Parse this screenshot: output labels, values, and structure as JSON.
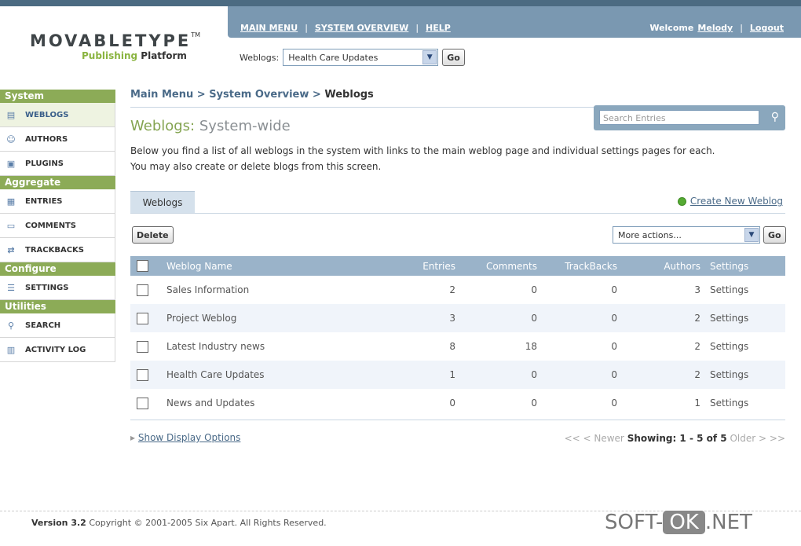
{
  "brand": {
    "logo_text": "MOVABLETYPE",
    "logo_tm": "TM",
    "sub1": "Publishing",
    "sub2": "Platform"
  },
  "topnav": {
    "items": [
      "MAIN MENU",
      "SYSTEM OVERVIEW",
      "HELP"
    ],
    "welcome": "Welcome",
    "user": "Melody",
    "logout": "Logout",
    "separator": "|"
  },
  "blog_selector": {
    "label": "Weblogs:",
    "selected": "Health Care Updates",
    "go": "Go"
  },
  "sidebar": {
    "sections": [
      {
        "title": "System",
        "items": [
          "WEBLOGS",
          "AUTHORS",
          "PLUGINS"
        ]
      },
      {
        "title": "Aggregate",
        "items": [
          "ENTRIES",
          "COMMENTS",
          "TRACKBACKS"
        ]
      },
      {
        "title": "Configure",
        "items": [
          "SETTINGS"
        ]
      },
      {
        "title": "Utilities",
        "items": [
          "SEARCH",
          "ACTIVITY LOG"
        ]
      }
    ]
  },
  "breadcrumb": {
    "items": [
      "Main Menu",
      "System Overview"
    ],
    "current": "Weblogs",
    "sep": ">"
  },
  "page": {
    "title_1": "Weblogs:",
    "title_2": "System-wide",
    "description_1": "Below you find a list of all weblogs in the system with links to the main weblog page and individual settings pages for each.",
    "description_2": "You may also create or delete blogs from this screen."
  },
  "search": {
    "placeholder": "Search Entries"
  },
  "tab": {
    "label": "Weblogs"
  },
  "actions": {
    "create": "Create New Weblog",
    "delete": "Delete",
    "more": "More actions...",
    "go": "Go"
  },
  "table": {
    "headers": [
      "Weblog Name",
      "Entries",
      "Comments",
      "TrackBacks",
      "Authors",
      "Settings"
    ],
    "rows": [
      {
        "name": "Sales Information",
        "entries": "2",
        "comments": "0",
        "trackbacks": "0",
        "authors": "3",
        "settings": "Settings"
      },
      {
        "name": "Project Weblog",
        "entries": "3",
        "comments": "0",
        "trackbacks": "0",
        "authors": "2",
        "settings": "Settings"
      },
      {
        "name": "Latest Industry news",
        "entries": "8",
        "comments": "18",
        "trackbacks": "0",
        "authors": "2",
        "settings": "Settings"
      },
      {
        "name": "Health Care Updates",
        "entries": "1",
        "comments": "0",
        "trackbacks": "0",
        "authors": "2",
        "settings": "Settings"
      },
      {
        "name": "News and Updates",
        "entries": "0",
        "comments": "0",
        "trackbacks": "0",
        "authors": "1",
        "settings": "Settings"
      }
    ]
  },
  "footer": {
    "show_display": "Show Display Options",
    "pager_first": "<<",
    "pager_newer": "< Newer",
    "pager_showing": "Showing: 1 - 5 of 5",
    "pager_older": "Older >",
    "pager_last": ">>",
    "version": "Version 3.2",
    "copyright": "Copyright © 2001-2005 Six Apart. All Rights Reserved."
  },
  "watermark": {
    "pre": "SOFT-",
    "ok": "OK",
    "post": ".NET"
  },
  "colors": {
    "nav_blue": "#7a98b1",
    "sidebar_green": "#8cab57",
    "header_row": "#9ab3c9"
  }
}
